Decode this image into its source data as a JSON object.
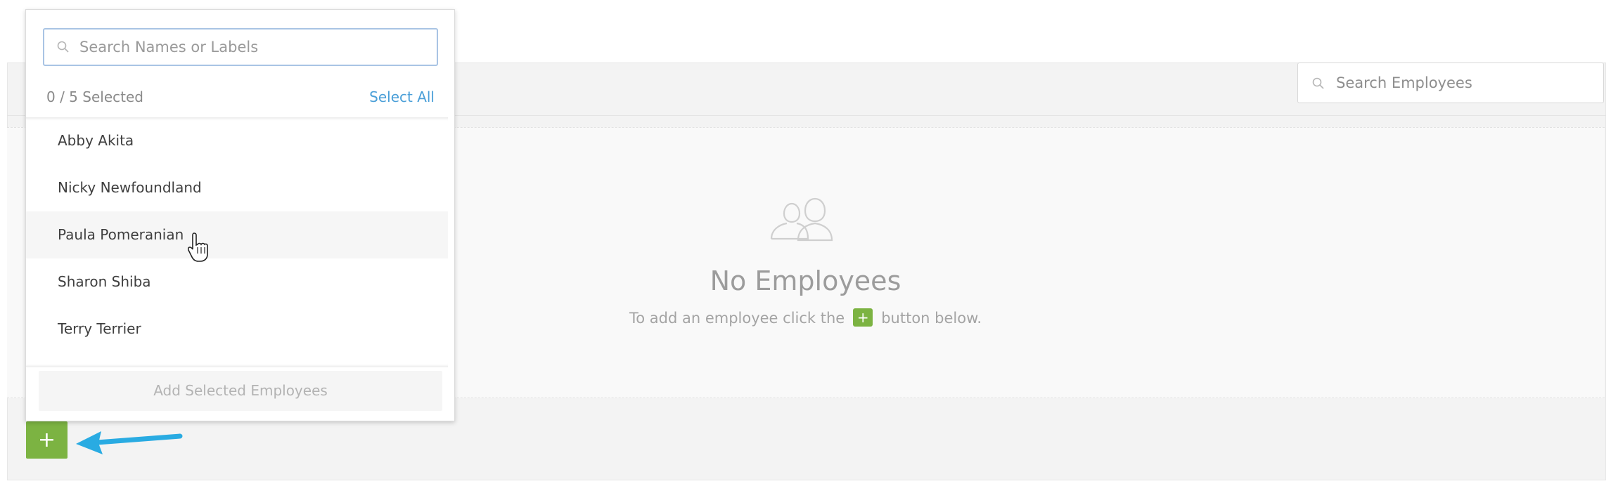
{
  "toolbar": {
    "search_employees_placeholder": "Search Employees"
  },
  "empty_state": {
    "title": "No Employees",
    "subtitle_prefix": "To add an employee click the",
    "subtitle_button": "+",
    "subtitle_suffix": "button below."
  },
  "add_button": {
    "label": "+"
  },
  "dropdown": {
    "search_placeholder": "Search Names or Labels",
    "selected_count": "0 / 5 Selected",
    "select_all_label": "Select All",
    "employees": [
      "Abby Akita",
      "Nicky Newfoundland",
      "Paula Pomeranian",
      "Sharon Shiba",
      "Terry Terrier"
    ],
    "add_selected_label": "Add Selected Employees"
  },
  "colors": {
    "accent_green": "#7cb342",
    "link_blue": "#4a9fd8",
    "arrow_blue": "#29abe2"
  }
}
